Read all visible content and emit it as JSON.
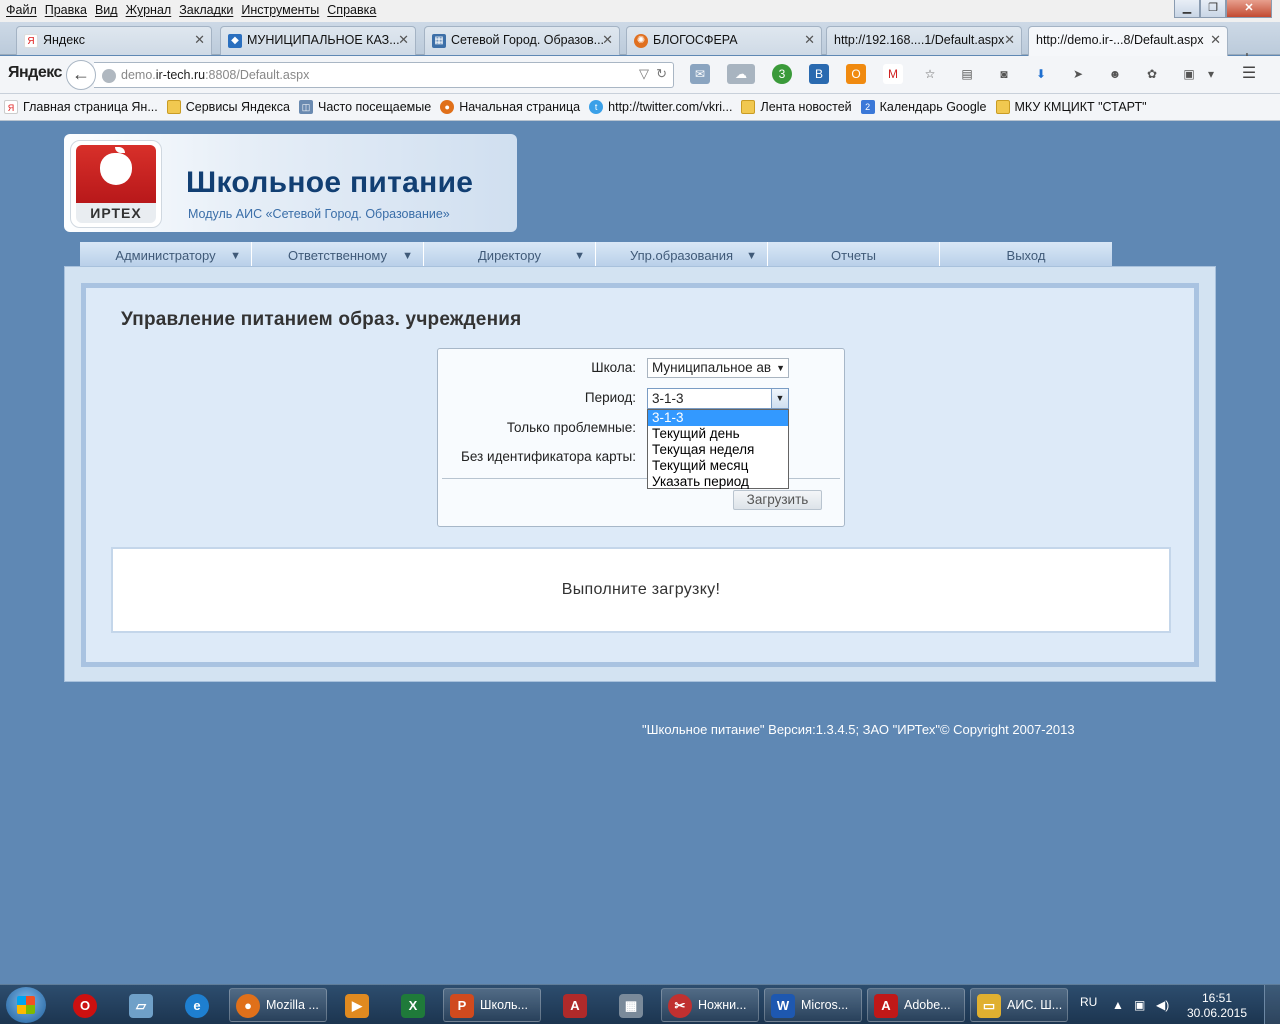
{
  "browser": {
    "menu": [
      "Файл",
      "Правка",
      "Вид",
      "Журнал",
      "Закладки",
      "Инструменты",
      "Справка"
    ],
    "tabs": [
      {
        "title": "Яндекс",
        "icon": "yandex-icon",
        "color": "#e02020"
      },
      {
        "title": "МУНИЦИПАЛЬНОЕ КАЗ...",
        "icon": "site-icon",
        "color": "#2a6fbf"
      },
      {
        "title": "Сетевой Город. Образов...",
        "icon": "page-icon",
        "color": "#3d6fa8"
      },
      {
        "title": "БЛОГОСФЕРА",
        "icon": "blog-icon",
        "color": "#e07020"
      },
      {
        "title": "http://192.168....1/Default.aspx",
        "icon": "",
        "color": ""
      },
      {
        "title": "http://demo.ir-...8/Default.aspx",
        "icon": "",
        "color": "",
        "active": true
      }
    ],
    "brand": "Яндекс",
    "url_host": "demo.",
    "url_domain": "ir-tech.ru",
    "url_rest": ":8808/Default.aspx",
    "bookmarks": [
      {
        "label": "Главная страница Ян...",
        "icon": "yandex-bookmark-icon"
      },
      {
        "label": "Сервисы Яндекса",
        "icon": "folder-icon"
      },
      {
        "label": "Часто посещаемые",
        "icon": "smart-folder-icon"
      },
      {
        "label": "Начальная страница",
        "icon": "firefox-icon"
      },
      {
        "label": "http://twitter.com/vkri...",
        "icon": "twitter-icon"
      },
      {
        "label": "Лента новостей",
        "icon": "rss-folder-icon"
      },
      {
        "label": "Календарь Google",
        "icon": "calendar-icon"
      },
      {
        "label": "МКУ КМЦИКТ \"СТАРТ\"",
        "icon": "folder-icon"
      }
    ]
  },
  "app": {
    "logo_text": "ИРТЕХ",
    "title": "Школьное питание",
    "subtitle": "Модуль АИС «Сетевой Город. Образование»",
    "nav": [
      {
        "label": "Администратору",
        "dropdown": true
      },
      {
        "label": "Ответственному",
        "dropdown": true
      },
      {
        "label": "Директору",
        "dropdown": true
      },
      {
        "label": "Упр.образования",
        "dropdown": true
      },
      {
        "label": "Отчеты",
        "dropdown": false
      },
      {
        "label": "Выход",
        "dropdown": false
      }
    ],
    "page_title": "Управление питанием образ. учреждения",
    "form": {
      "school_label": "Школа:",
      "school_value": "Муниципальное ав",
      "period_label": "Период:",
      "period_value": "3-1-3",
      "problems_label": "Только проблемные:",
      "nocard_label": "Без идентификатора карты:",
      "period_options": [
        "3-1-3",
        "Текущий день",
        "Текущая неделя",
        "Текущий месяц",
        "Указать период"
      ],
      "load_button": "Загрузить"
    },
    "result_message": "Выполните загрузку!",
    "footer": "\"Школьное питание\" Версия:1.3.4.5; ЗАО \"ИРТех\"© Copyright 2007-2013"
  },
  "taskbar": {
    "apps": [
      {
        "label": "",
        "icon": "opera-icon",
        "color": "#cc1010"
      },
      {
        "label": "",
        "icon": "notes-icon",
        "color": "#6fa0c8"
      },
      {
        "label": "",
        "icon": "ie-icon",
        "color": "#1e7fd0"
      },
      {
        "label": "Mozilla ...",
        "icon": "firefox-icon",
        "color": "#e0701a"
      },
      {
        "label": "",
        "icon": "media-player-icon",
        "color": "#e08a20"
      },
      {
        "label": "",
        "icon": "excel-icon",
        "color": "#1f7a3a"
      },
      {
        "label": "Школь...",
        "icon": "powerpoint-icon",
        "color": "#d04a1e"
      },
      {
        "label": "",
        "icon": "access-icon",
        "color": "#b02a2a"
      },
      {
        "label": "",
        "icon": "calculator-icon",
        "color": "#7a8a9a"
      },
      {
        "label": "Ножни...",
        "icon": "scissors-icon",
        "color": "#c03030"
      },
      {
        "label": "Micros...",
        "icon": "word-icon",
        "color": "#1e58b0"
      },
      {
        "label": "Adobe...",
        "icon": "adobe-icon",
        "color": "#c01818"
      },
      {
        "label": "АИС. Ш...",
        "icon": "folder-icon",
        "color": "#e0b030"
      }
    ],
    "lang": "RU",
    "time": "16:51",
    "date": "30.06.2015"
  }
}
